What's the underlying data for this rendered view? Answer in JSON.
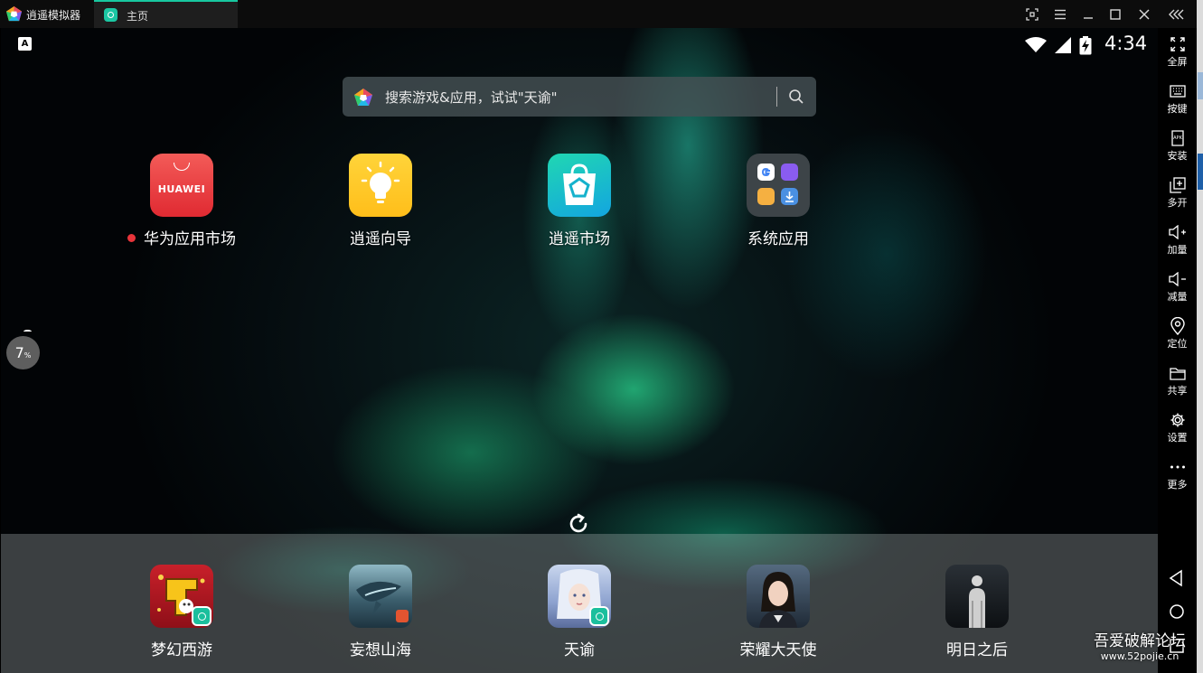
{
  "window": {
    "title": "逍遥模拟器",
    "tab_label": "主页",
    "controls": [
      "fullscreen-icon",
      "menu-icon",
      "minimize-icon",
      "maximize-icon",
      "close-icon",
      "collapse-icon"
    ]
  },
  "status_bar": {
    "notification_letter": "A",
    "time": "4:34"
  },
  "search": {
    "placeholder": "搜索游戏&应用，试试\"天谕\""
  },
  "apps": [
    {
      "label": "华为应用市场",
      "icon": "huawei-icon",
      "has_dot": true
    },
    {
      "label": "逍遥向导",
      "icon": "lightbulb-icon"
    },
    {
      "label": "逍遥市场",
      "icon": "market-bag-icon"
    },
    {
      "label": "系统应用",
      "icon": "folder-icon"
    }
  ],
  "perf_widget": {
    "value": "7",
    "unit": "%"
  },
  "dock": [
    {
      "label": "梦幻西游"
    },
    {
      "label": "妄想山海"
    },
    {
      "label": "天谕"
    },
    {
      "label": "荣耀大天使"
    },
    {
      "label": "明日之后"
    }
  ],
  "toolbar": [
    {
      "label": "全屏",
      "icon": "fullscreen-icon"
    },
    {
      "label": "按键",
      "icon": "keyboard-icon"
    },
    {
      "label": "安装",
      "icon": "apk-icon"
    },
    {
      "label": "多开",
      "icon": "multi-instance-icon"
    },
    {
      "label": "加量",
      "icon": "volume-up-icon"
    },
    {
      "label": "减量",
      "icon": "volume-down-icon"
    },
    {
      "label": "定位",
      "icon": "location-icon"
    },
    {
      "label": "共享",
      "icon": "folder-share-icon"
    },
    {
      "label": "设置",
      "icon": "gear-icon"
    },
    {
      "label": "更多",
      "icon": "more-icon"
    }
  ],
  "watermark": {
    "line1": "吾爱破解论坛",
    "line2": "www.52pojie.cn"
  },
  "colors": {
    "accent": "#18c8a0",
    "titlebar": "#0c0c0c",
    "badge_red": "#e8343a"
  }
}
